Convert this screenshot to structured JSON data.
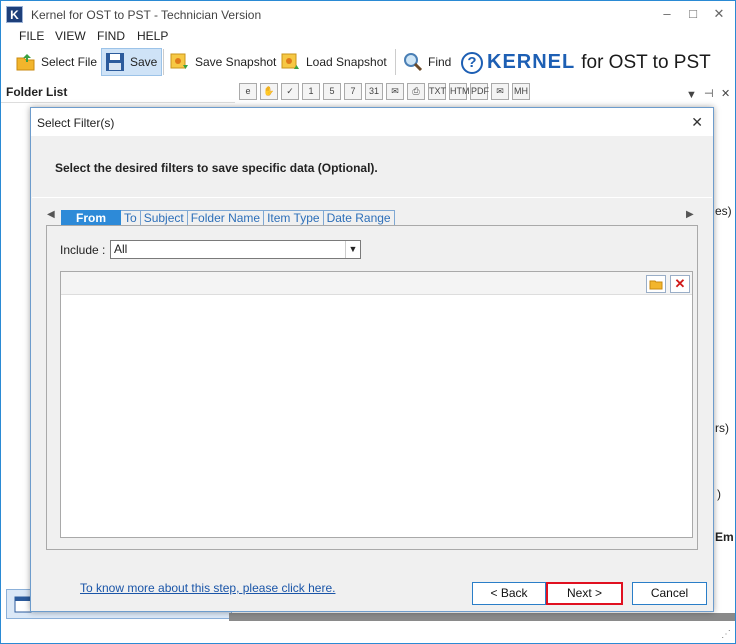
{
  "window": {
    "title": "Kernel for OST to PST - Technician Version",
    "app_icon_letter": "K",
    "controls": {
      "minimize": "–",
      "maximize": "□",
      "close": "✕"
    }
  },
  "menu": [
    "FILE",
    "VIEW",
    "FIND",
    "HELP"
  ],
  "toolbar": {
    "select_file": "Select File",
    "save": "Save",
    "save_snapshot": "Save Snapshot",
    "load_snapshot": "Load Snapshot",
    "find": "Find"
  },
  "brand": {
    "q": "?",
    "kernel": "KERNEL",
    "product": "for OST to PST"
  },
  "left_pane": {
    "label": "Folder List"
  },
  "icon_strip": [
    "e",
    "✋",
    "✓",
    "1",
    "5",
    "7",
    "31",
    "✉",
    "⎙",
    "TXT",
    "HTM",
    "PDF",
    "✉",
    "MH"
  ],
  "background_fragments": {
    "frag_1": "es)",
    "frag_2": "rs)",
    "frag_3": ")",
    "frag_4": "Em"
  },
  "dialog": {
    "title": "Select Filter(s)",
    "close": "✕",
    "instruction": "Select the desired filters to save specific data (Optional).",
    "tabs": [
      "From",
      "To",
      "Subject",
      "Folder Name",
      "Item Type",
      "Date Range"
    ],
    "active_tab": "From",
    "include_label": "Include :",
    "include_value": "All",
    "help_link": "To know more about this step, please click here.",
    "back_button": "< Back",
    "next_button": "Next >",
    "cancel_button": "Cancel"
  },
  "colors": {
    "accent": "#2d8ad8",
    "border_blue": "#2a7ec8",
    "focus_red": "#e01020",
    "brand_blue": "#1d5fb4"
  }
}
